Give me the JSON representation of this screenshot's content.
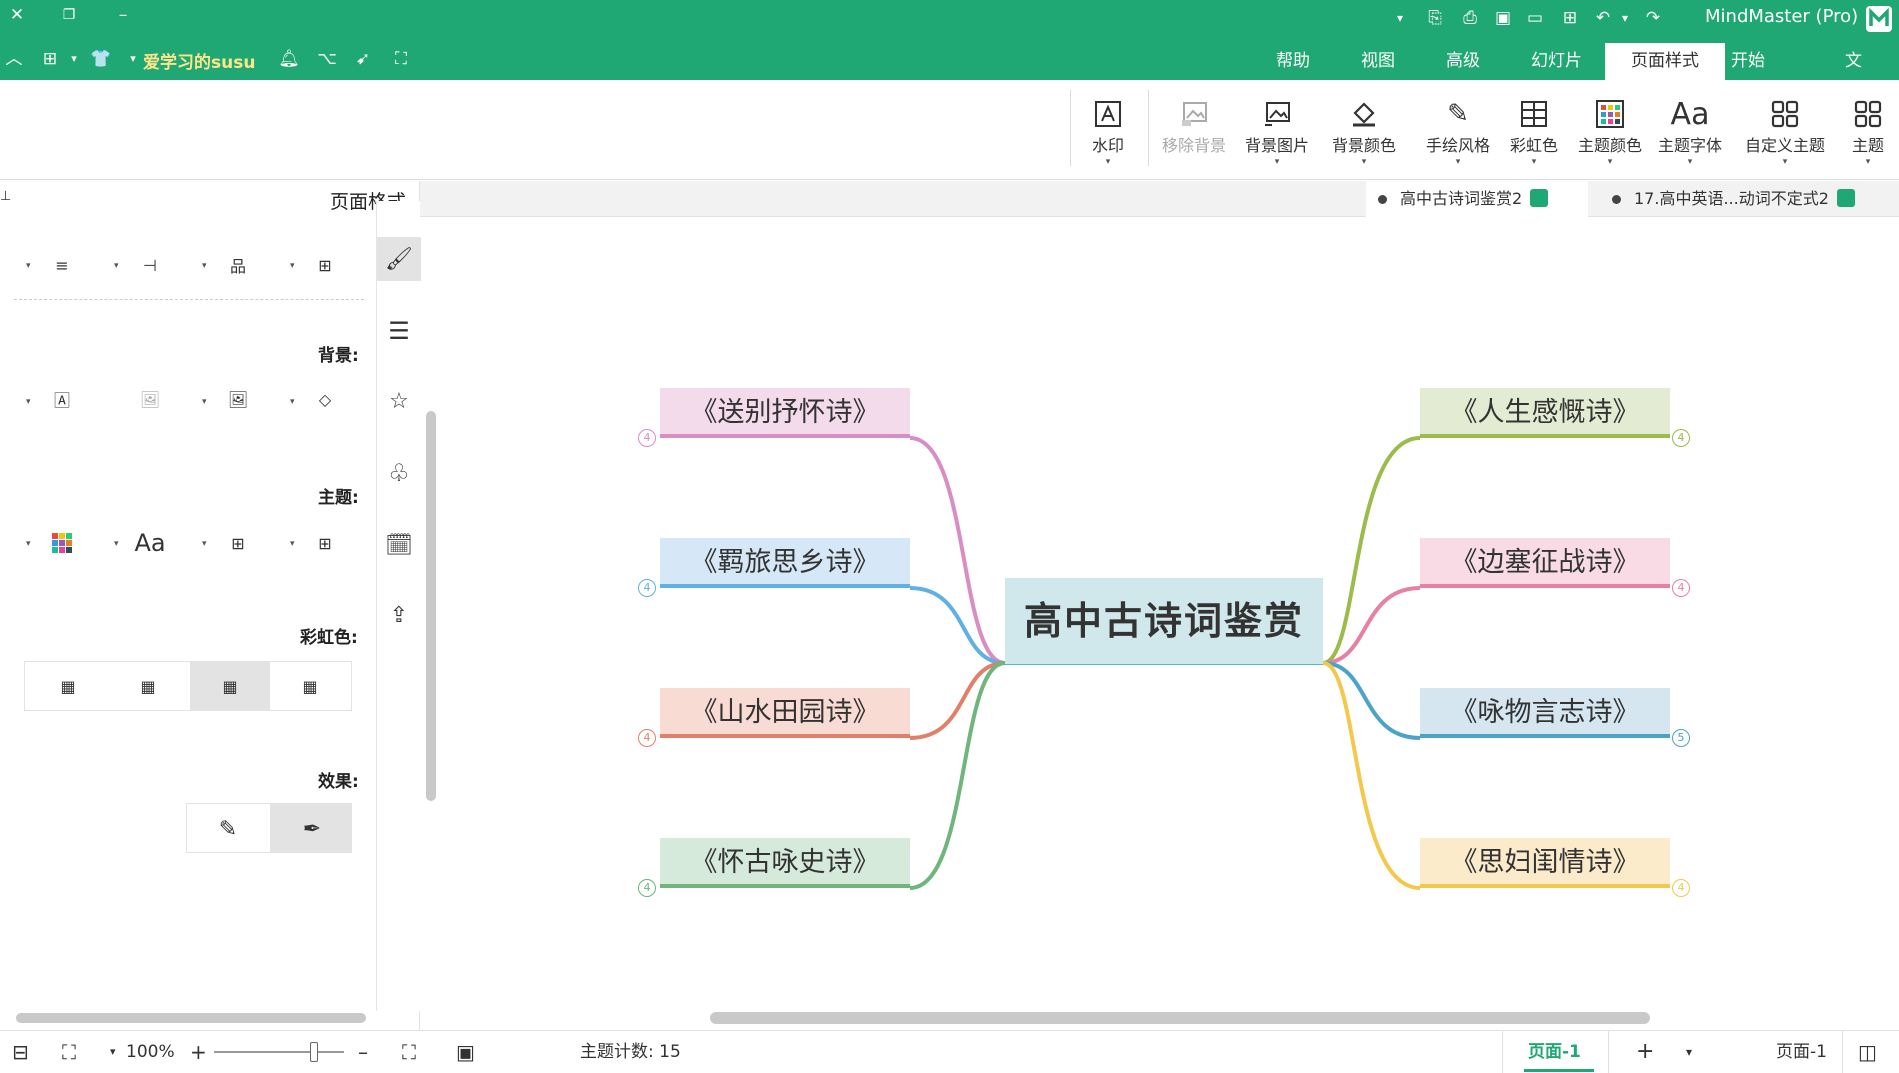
{
  "app": {
    "title": "MindMaster (Pro)",
    "brand_color": "#1fa774",
    "user_label": "爱学习的susu"
  },
  "menu_tabs": [
    {
      "label": "文件"
    },
    {
      "label": "开始"
    },
    {
      "label": "页面样式",
      "active": true
    },
    {
      "label": "幻灯片"
    },
    {
      "label": "高级"
    },
    {
      "label": "视图"
    },
    {
      "label": "帮助"
    }
  ],
  "ribbon": {
    "buttons": [
      {
        "label": "主题",
        "icon": "theme-grid-icon"
      },
      {
        "label": "自定义主题",
        "icon": "custom-theme-icon"
      },
      {
        "label": "主题字体",
        "icon": "font-aa-icon"
      },
      {
        "label": "主题颜色",
        "icon": "color-palette-icon"
      },
      {
        "label": "彩虹色",
        "icon": "rainbow-grid-icon"
      },
      {
        "label": "手绘风格",
        "icon": "hand-draw-icon"
      },
      {
        "label": "背景颜色",
        "icon": "paint-bucket-icon"
      },
      {
        "label": "背景图片",
        "icon": "bg-image-icon"
      },
      {
        "label": "移除背景",
        "icon": "remove-bg-icon",
        "disabled": true
      },
      {
        "label": "水印",
        "icon": "watermark-icon"
      }
    ]
  },
  "doc_tabs": [
    {
      "label": "17.高中英语...动词不定式2"
    },
    {
      "label": "高中古诗词鉴赏2",
      "active": true
    }
  ],
  "side_panel": {
    "title": "页面格式",
    "background_label": "背景:",
    "theme_label": "主题:",
    "rainbow_label": "彩虹色:",
    "effect_label": "效果:"
  },
  "mindmap": {
    "center": "高中古诗词鉴赏",
    "right_topics": [
      {
        "label": "《人生感慨诗》",
        "count": "4",
        "color": "#9bbb4a",
        "fill": "#e3ecd2"
      },
      {
        "label": "《边塞征战诗》",
        "count": "4",
        "color": "#e87fa5",
        "fill": "#f8dbe5"
      },
      {
        "label": "《咏物言志诗》",
        "count": "5",
        "color": "#4ba3c8",
        "fill": "#d5e6f0"
      },
      {
        "label": "《思妇闺情诗》",
        "count": "4",
        "color": "#f2c94c",
        "fill": "#fbebcb"
      }
    ],
    "left_topics": [
      {
        "label": "《送别抒怀诗》",
        "count": "4",
        "color": "#d98ec3",
        "fill": "#f4dbeb"
      },
      {
        "label": "《羁旅思乡诗》",
        "count": "4",
        "color": "#5fb1e3",
        "fill": "#d6e8f7"
      },
      {
        "label": "《山水田园诗》",
        "count": "4",
        "color": "#e0806a",
        "fill": "#f8dcd3"
      },
      {
        "label": "《怀古咏史诗》",
        "count": "4",
        "color": "#6fb57c",
        "fill": "#d6eadb"
      }
    ]
  },
  "status": {
    "topic_count": "主题计数: 15",
    "zoom": "100%",
    "page_tab": "页面-1",
    "page_label": "页面-1"
  }
}
